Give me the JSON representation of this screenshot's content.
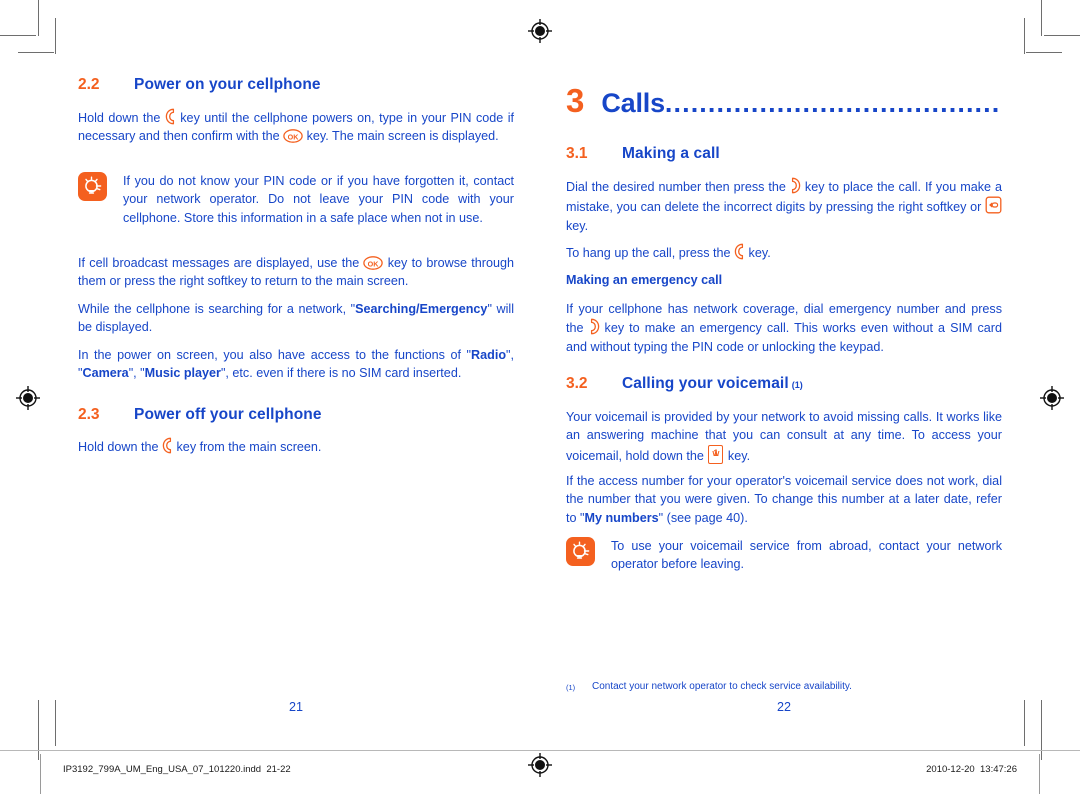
{
  "document": {
    "left_page_number": "21",
    "right_page_number": "22",
    "accent_orange": "#F4601F",
    "accent_blue": "#1746C8"
  },
  "left_column": {
    "section_22": {
      "number": "2.2",
      "title": "Power on your cellphone",
      "paragraph_1_part1": "Hold down the ",
      "paragraph_1_part2": " key until the cellphone powers on, type in your PIN code if necessary and then confirm with the ",
      "paragraph_1_part3": " key. The main screen is displayed.",
      "tip": "If you do not know your PIN code or if you have forgotten it, contact your network operator. Do not leave your PIN code with your cellphone. Store this information in a safe place when not in use.",
      "paragraph_2_part1": "If cell broadcast messages are displayed, use the ",
      "paragraph_2_part2": " key to browse through them or press the right softkey to return to the main screen.",
      "paragraph_3_part1": "While the cellphone is searching for a network, \"",
      "paragraph_3_bold": "Searching/Emergency",
      "paragraph_3_part2": "\" will be displayed.",
      "paragraph_4_part1": "In the power on screen, you also have access to the functions of \"",
      "paragraph_4_bold1": "Radio",
      "paragraph_4_part2": "\", \"",
      "paragraph_4_bold2": "Camera",
      "paragraph_4_part3": "\", \"",
      "paragraph_4_bold3": "Music player",
      "paragraph_4_part4": "\", etc. even if there is no SIM card inserted."
    },
    "section_23": {
      "number": "2.3",
      "title": "Power off your cellphone",
      "paragraph_1_part1": "Hold down the ",
      "paragraph_1_part2": " key from the main screen."
    }
  },
  "right_column": {
    "chapter": {
      "number": "3",
      "title": "Calls",
      "dots": "........................................."
    },
    "section_31": {
      "number": "3.1",
      "title": "Making a call",
      "paragraph_1_part1": "Dial the desired number then press the ",
      "paragraph_1_part2": " key to place the call. If you make a mistake, you can delete the incorrect digits by pressing the right softkey or ",
      "paragraph_1_part3": " key.",
      "paragraph_2_part1": "To hang up the call, press the ",
      "paragraph_2_part2": " key.",
      "subheading": "Making an emergency call",
      "paragraph_3_part1": "If your cellphone has network coverage, dial emergency number and press the ",
      "paragraph_3_part2": " key to make an emergency call. This works even without a SIM card and without typing the PIN code or unlocking the keypad."
    },
    "section_32": {
      "number": "3.2",
      "title": "Calling your voicemail",
      "footnote_marker": "(1)",
      "paragraph_1_part1": "Your voicemail is provided by your network to avoid missing calls. It works like an answering machine that you can consult at any time. To access your voicemail, hold down the ",
      "paragraph_1_part2": " key.",
      "paragraph_2_part1": "If the access number for your operator's voicemail service does not work, dial the number that you were given. To change this number at a later date, refer to \"",
      "paragraph_2_bold": "My numbers",
      "paragraph_2_part2": "\" (see page 40).",
      "tip": "To use your voicemail service from abroad, contact your network operator before leaving."
    },
    "footnote": {
      "marker": "(1)",
      "text": "Contact your network operator to check service availability."
    }
  },
  "keys": {
    "hangup_key": "hangup-key",
    "ok_key": "OK",
    "call_key": "call-key",
    "delete_key": "delete-key",
    "voicemail_key_top": "1",
    "voicemail_key_bottom": "W"
  },
  "slug": {
    "filename": "IP3192_799A_UM_Eng_USA_07_101220.indd",
    "pages": "21-22",
    "date": "2010-12-20",
    "time": "13:47:26"
  }
}
